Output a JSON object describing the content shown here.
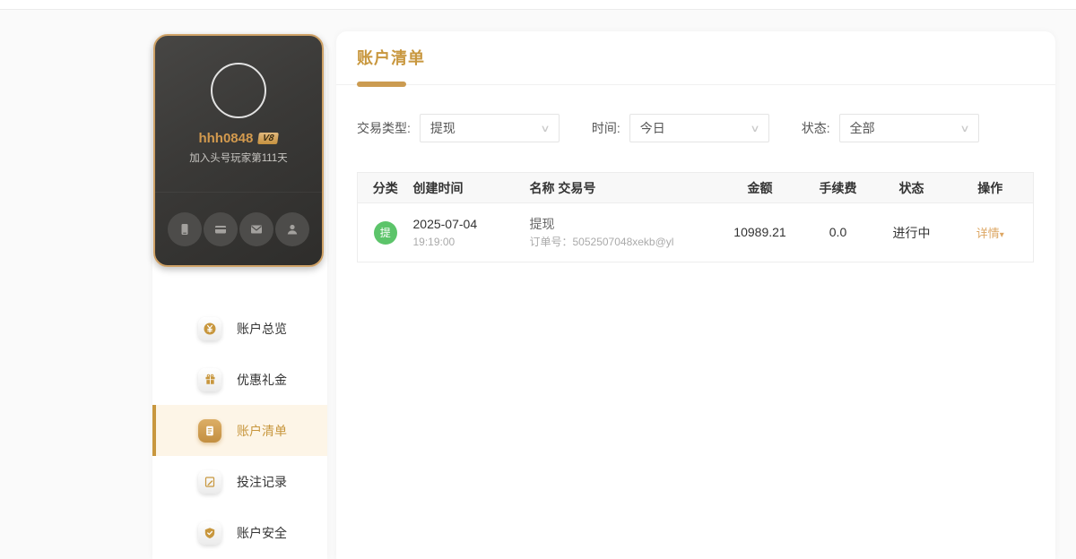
{
  "user_card": {
    "username": "hhh0848",
    "vip_badge": "V8",
    "join_text": "加入头号玩家第111天"
  },
  "sidebar": {
    "items": [
      {
        "label": "账户总览"
      },
      {
        "label": "优惠礼金"
      },
      {
        "label": "账户清单"
      },
      {
        "label": "投注记录"
      },
      {
        "label": "账户安全"
      }
    ]
  },
  "main": {
    "title": "账户清单",
    "filters": [
      {
        "label": "交易类型:",
        "value": "提现"
      },
      {
        "label": "时间:",
        "value": "今日"
      },
      {
        "label": "状态:",
        "value": "全部"
      }
    ],
    "table": {
      "headers": [
        "分类",
        "创建时间",
        "名称 交易号",
        "金额",
        "手续费",
        "状态",
        "操作"
      ],
      "rows": [
        {
          "category_badge": "提",
          "date": "2025-07-04",
          "time": "19:19:00",
          "name": "提现",
          "order_no": "订单号：5052507048xekb@yl",
          "amount": "10989.21",
          "fee": "0.0",
          "status": "进行中",
          "action": "详情"
        }
      ]
    }
  },
  "icons": {
    "chevron_down": "∨",
    "caret_down": "▾"
  },
  "colors": {
    "gold": "#c8973e",
    "gold_light": "#dda764",
    "green": "#5cc46a",
    "card_border": "#cfa267",
    "active_bg": "#fdf5e7"
  }
}
